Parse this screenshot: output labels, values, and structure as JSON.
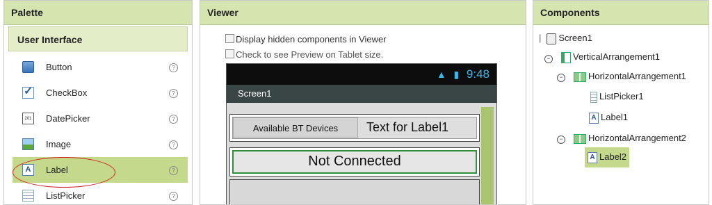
{
  "palette": {
    "header": "Palette",
    "subheader": "User Interface",
    "items": [
      {
        "label": "Button",
        "icon": "button-icon"
      },
      {
        "label": "CheckBox",
        "icon": "checkbox-icon"
      },
      {
        "label": "DatePicker",
        "icon": "datepicker-icon"
      },
      {
        "label": "Image",
        "icon": "image-icon"
      },
      {
        "label": "Label",
        "icon": "label-icon",
        "selected": true
      },
      {
        "label": "ListPicker",
        "icon": "listpicker-icon"
      }
    ],
    "help_glyph": "?",
    "datepicker_glyph": "201"
  },
  "viewer": {
    "header": "Viewer",
    "display_hidden_label": "Display hidden components in Viewer",
    "tablet_preview_label": "Check to see Preview on Tablet size.",
    "phone": {
      "status_time": "9:48",
      "screen_title": "Screen1",
      "button_text": "Available BT Devices",
      "label1_text": "Text for Label1",
      "label2_text": "Not Connected"
    }
  },
  "components": {
    "header": "Components",
    "tree": [
      {
        "name": "Screen1",
        "icon": "screen-icon"
      },
      {
        "name": "VerticalArrangement1",
        "icon": "vertical-arrangement-icon"
      },
      {
        "name": "HorizontalArrangement1",
        "icon": "horizontal-arrangement-icon"
      },
      {
        "name": "ListPicker1",
        "icon": "listpicker-icon"
      },
      {
        "name": "Label1",
        "icon": "label-icon"
      },
      {
        "name": "HorizontalArrangement2",
        "icon": "horizontal-arrangement-icon"
      },
      {
        "name": "Label2",
        "icon": "label-icon",
        "selected": true
      }
    ],
    "collapse_glyph": "−"
  },
  "colors": {
    "header_green": "#d6e5b0",
    "selected_green": "#c5d98d",
    "highlight_oval": "#d02020",
    "status_blue": "#3fb6e8"
  }
}
